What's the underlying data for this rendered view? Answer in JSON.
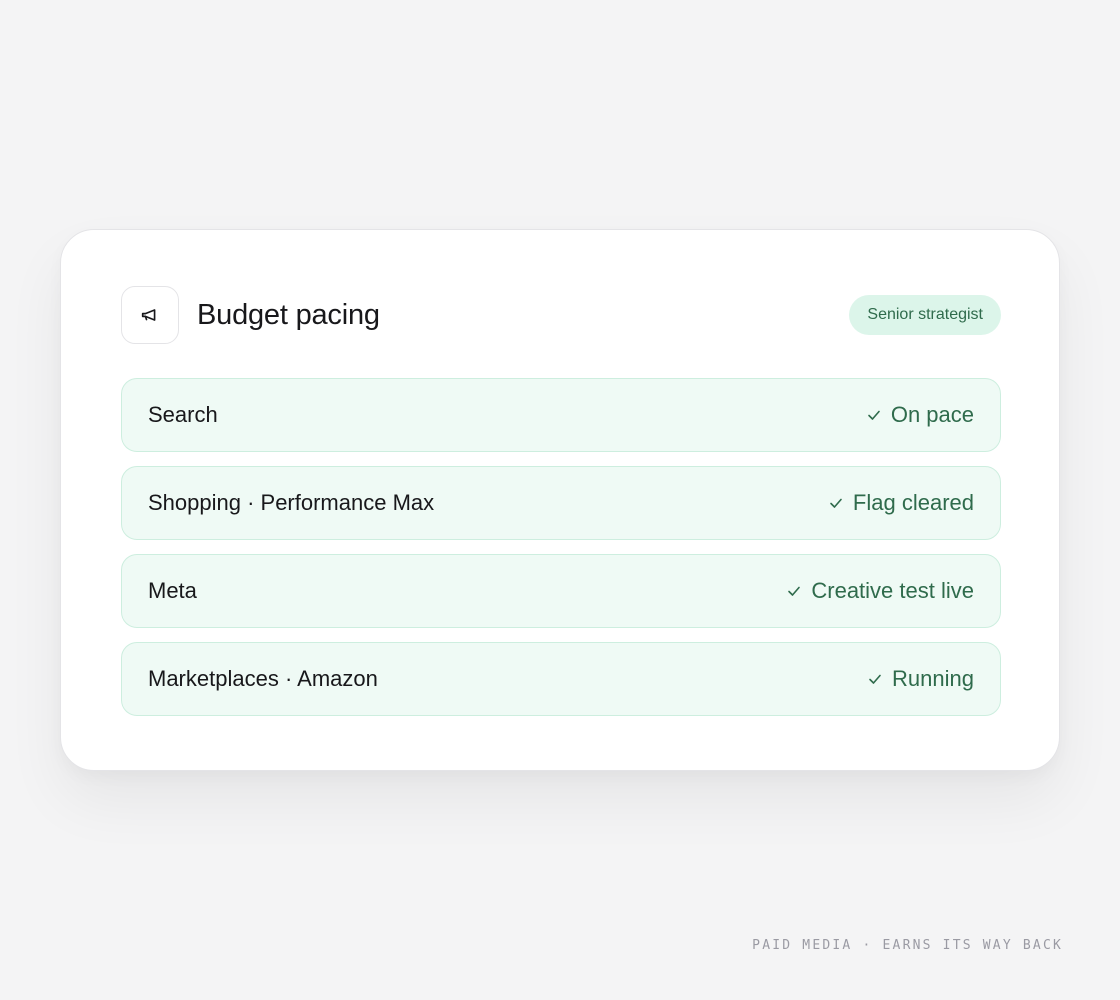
{
  "card": {
    "icon": "megaphone-icon",
    "title": "Budget pacing",
    "badge": "Senior strategist"
  },
  "rows": [
    {
      "label": "Search",
      "status": "On pace",
      "status_icon": "check-icon"
    },
    {
      "label": "Shopping · Performance Max",
      "status": "Flag cleared",
      "status_icon": "check-icon"
    },
    {
      "label": "Meta",
      "status": "Creative test live",
      "status_icon": "check-icon"
    },
    {
      "label": "Marketplaces · Amazon",
      "status": "Running",
      "status_icon": "check-icon"
    }
  ],
  "footer": {
    "tagline": "PAID MEDIA · EARNS ITS WAY BACK"
  },
  "colors": {
    "accent_text": "#2f6b4c",
    "badge_bg": "#dcf5ea",
    "row_bg": "#effaf5",
    "row_border": "#cdeedf"
  }
}
